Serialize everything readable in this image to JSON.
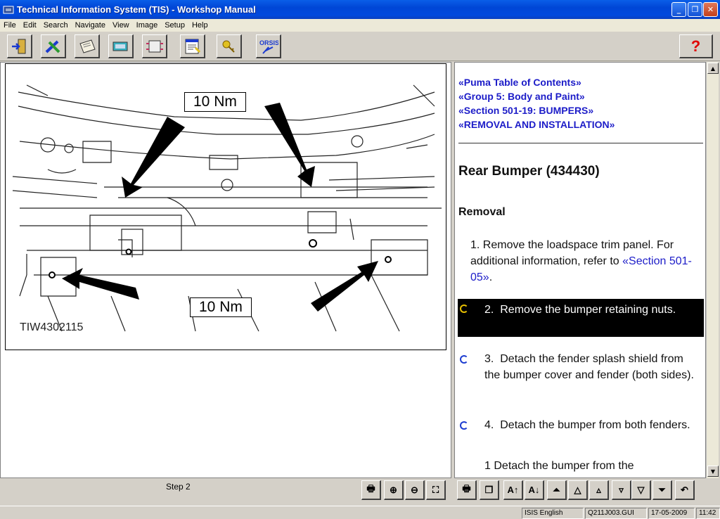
{
  "window": {
    "title": "Technical Information System (TIS) - Workshop Manual"
  },
  "menu": [
    "File",
    "Edit",
    "Search",
    "Navigate",
    "View",
    "Image",
    "Setup",
    "Help"
  ],
  "toolbar": {
    "orsis_label": "ORSIS",
    "help_label": "?"
  },
  "figure": {
    "id": "TIW4302115",
    "torque_labels": [
      "10 Nm",
      "10 Nm"
    ]
  },
  "breadcrumbs": [
    "«Puma Table of Contents»",
    "«Group 5: Body and Paint»",
    "«Section 501-19: BUMPERS»",
    "«REMOVAL AND INSTALLATION»"
  ],
  "content": {
    "title": "Rear Bumper (434430)",
    "section": "Removal",
    "steps": [
      {
        "num": "1.",
        "text": "Remove the loadspace trim panel. For additional information, refer to",
        "link": "«Section 501-05»",
        "after": "."
      },
      {
        "num": "2.",
        "text": "Remove the bumper retaining nuts."
      },
      {
        "num": "3.",
        "text": "Detach the fender splash shield from the bumper cover and fender (both sides)."
      },
      {
        "num": "4.",
        "text": "Detach the bumper from both fenders."
      },
      {
        "num": "1",
        "text": "Detach the bumper from the"
      }
    ]
  },
  "bottom": {
    "step_label": "Step 2",
    "btn_labels": [
      "A↑",
      "A↓"
    ]
  },
  "status": [
    "ISIS English",
    "Q211J003.GUI",
    "17-05-2009",
    "11:42"
  ]
}
